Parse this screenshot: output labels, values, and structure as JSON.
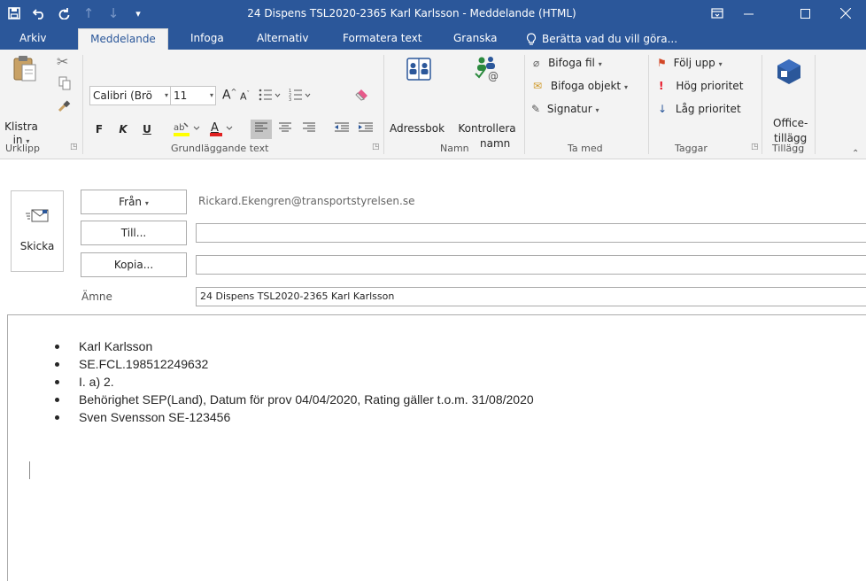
{
  "window": {
    "title": "24 Dispens TSL2020-2365 Karl Karlsson - Meddelande (HTML)",
    "accent_color": "#2b579a",
    "qat_icons": [
      "save-icon",
      "undo-icon",
      "redo-icon",
      "up-arrow-icon",
      "down-arrow-icon",
      "customize-icon"
    ],
    "controls": [
      "ribbon-display-icon",
      "minimize-icon",
      "maximize-icon",
      "close-icon"
    ]
  },
  "tabs": [
    "Arkiv",
    "Meddelande",
    "Infoga",
    "Alternativ",
    "Formatera text",
    "Granska"
  ],
  "active_tab": "Meddelande",
  "tell_me": "Berätta vad du vill göra...",
  "ribbon": {
    "clipboard": {
      "paste_label_1": "Klistra",
      "paste_label_2": "in",
      "group_label": "Urklipp"
    },
    "basic_text": {
      "font_name": "Calibri (Brö",
      "font_size": "11",
      "bold": "F",
      "italic": "K",
      "underline": "U",
      "group_label": "Grundläggande text"
    },
    "names": {
      "address_book": "Adressbok",
      "check_names_1": "Kontrollera",
      "check_names_2": "namn",
      "group_label": "Namn"
    },
    "include": {
      "attach_file": "Bifoga fil",
      "attach_item": "Bifoga objekt",
      "signature": "Signatur",
      "group_label": "Ta med"
    },
    "tags": {
      "follow_up": "Följ upp",
      "high_priority": "Hög prioritet",
      "low_priority": "Låg prioritet",
      "group_label": "Taggar"
    },
    "addins": {
      "office_1": "Office-",
      "office_2": "tillägg",
      "group_label": "Tillägg"
    }
  },
  "compose": {
    "send_label": "Skicka",
    "from_label": "Från",
    "from_value": "Rickard.Ekengren@transportstyrelsen.se",
    "to_label": "Till...",
    "to_value": "",
    "cc_label": "Kopia...",
    "cc_value": "",
    "subject_label": "Ämne",
    "subject_value": "24 Dispens TSL2020-2365 Karl Karlsson"
  },
  "body": {
    "bullets": [
      "Karl Karlsson",
      "SE.FCL.198512249632",
      "I. a) 2.",
      "Behörighet SEP(Land), Datum för prov 04/04/2020, Rating gäller t.o.m. 31/08/2020",
      "Sven Svensson SE-123456"
    ]
  }
}
